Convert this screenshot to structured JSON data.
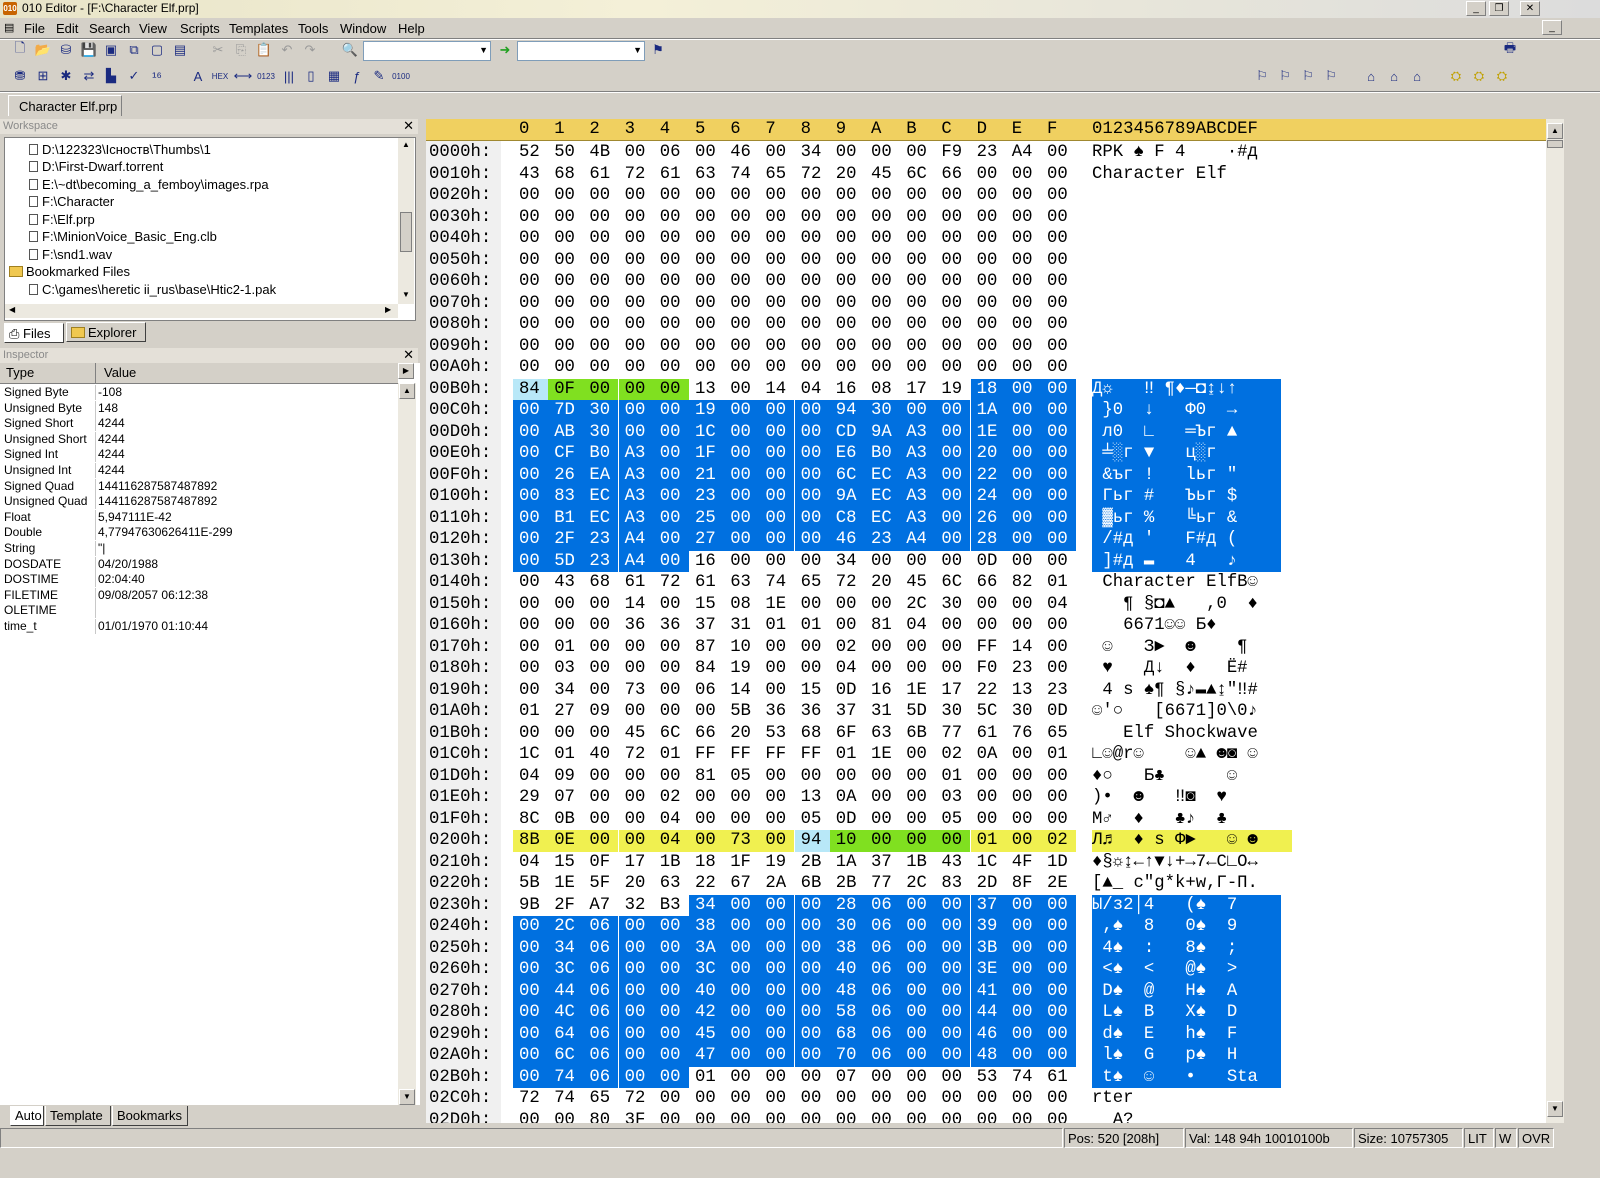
{
  "window": {
    "title": "010 Editor - [F:\\Character Elf.prp]",
    "app_icon": "010"
  },
  "menu": [
    "File",
    "Edit",
    "Search",
    "View",
    "Scripts",
    "Templates",
    "Tools",
    "Window",
    "Help"
  ],
  "toolbar": {
    "find_value": "",
    "goto_value": ""
  },
  "doc_tab": "Character Elf.prp",
  "workspace": {
    "title": "Workspace",
    "files": [
      "D:\\122323\\Існоств\\Thumbs\\1",
      "D:\\First-Dwarf.torrent",
      "E:\\~dt\\becoming_a_femboy\\images.rpa",
      "F:\\Character",
      "F:\\Elf.prp",
      "F:\\MinionVoice_Basic_Eng.clb",
      "F:\\snd1.wav"
    ],
    "bookmarked_label": "Bookmarked Files",
    "bookmarked": [
      "C:\\games\\heretic ii_rus\\base\\Htic2-1.pak"
    ],
    "tabs": [
      "Files",
      "Explorer"
    ]
  },
  "inspector": {
    "title": "Inspector",
    "col_type": "Type",
    "col_value": "Value",
    "rows": [
      {
        "type": "Signed Byte",
        "value": "-108"
      },
      {
        "type": "Unsigned Byte",
        "value": "148"
      },
      {
        "type": "Signed Short",
        "value": "4244"
      },
      {
        "type": "Unsigned Short",
        "value": "4244"
      },
      {
        "type": "Signed Int",
        "value": "4244"
      },
      {
        "type": "Unsigned Int",
        "value": "4244"
      },
      {
        "type": "Signed Quad",
        "value": "144116287587487892"
      },
      {
        "type": "Unsigned Quad",
        "value": "144116287587487892"
      },
      {
        "type": "Float",
        "value": "5,947111E-42"
      },
      {
        "type": "Double",
        "value": "4,77947630626411E-299"
      },
      {
        "type": "String",
        "value": "\"|"
      },
      {
        "type": "DOSDATE",
        "value": "04/20/1988"
      },
      {
        "type": "DOSTIME",
        "value": "02:04:40"
      },
      {
        "type": "FILETIME",
        "value": "09/08/2057 06:12:38"
      },
      {
        "type": "OLETIME",
        "value": ""
      },
      {
        "type": "time_t",
        "value": "01/01/1970 01:10:44"
      }
    ],
    "tabs": [
      "Auto",
      "Template",
      "Bookmarks"
    ]
  },
  "hex": {
    "columns": [
      "0",
      "1",
      "2",
      "3",
      "4",
      "5",
      "6",
      "7",
      "8",
      "9",
      "A",
      "B",
      "C",
      "D",
      "E",
      "F"
    ],
    "ascii_header": "0123456789ABCDEF",
    "rows": [
      {
        "addr": "0000h:",
        "bytes": "52 50 4B 00 06 00 46 00 34 00 00 00 F9 23 A4 00",
        "ascii": "RPK ♠ F 4    ·#д"
      },
      {
        "addr": "0010h:",
        "bytes": "43 68 61 72 61 63 74 65 72 20 45 6C 66 00 00 00",
        "ascii": "Character Elf"
      },
      {
        "addr": "0020h:",
        "bytes": "00 00 00 00 00 00 00 00 00 00 00 00 00 00 00 00",
        "ascii": ""
      },
      {
        "addr": "0030h:",
        "bytes": "00 00 00 00 00 00 00 00 00 00 00 00 00 00 00 00",
        "ascii": ""
      },
      {
        "addr": "0040h:",
        "bytes": "00 00 00 00 00 00 00 00 00 00 00 00 00 00 00 00",
        "ascii": ""
      },
      {
        "addr": "0050h:",
        "bytes": "00 00 00 00 00 00 00 00 00 00 00 00 00 00 00 00",
        "ascii": ""
      },
      {
        "addr": "0060h:",
        "bytes": "00 00 00 00 00 00 00 00 00 00 00 00 00 00 00 00",
        "ascii": ""
      },
      {
        "addr": "0070h:",
        "bytes": "00 00 00 00 00 00 00 00 00 00 00 00 00 00 00 00",
        "ascii": ""
      },
      {
        "addr": "0080h:",
        "bytes": "00 00 00 00 00 00 00 00 00 00 00 00 00 00 00 00",
        "ascii": ""
      },
      {
        "addr": "0090h:",
        "bytes": "00 00 00 00 00 00 00 00 00 00 00 00 00 00 00 00",
        "ascii": ""
      },
      {
        "addr": "00A0h:",
        "bytes": "00 00 00 00 00 00 00 00 00 00 00 00 00 00 00 00",
        "ascii": ""
      },
      {
        "addr": "00B0h:",
        "bytes": "84 0F 00 00 00 13 00 14 04 16 08 17 19 18 00 00",
        "ascii": "Д☼   ‼ ¶♦—◘↨↓↑  "
      },
      {
        "addr": "00C0h:",
        "bytes": "00 7D 30 00 00 19 00 00 00 94 30 00 00 1A 00 00",
        "ascii": " }0  ↓   Ф0  →  "
      },
      {
        "addr": "00D0h:",
        "bytes": "00 AB 30 00 00 1C 00 00 00 CD 9A A3 00 1E 00 00",
        "ascii": " л0  ∟   ═Ъг ▲  "
      },
      {
        "addr": "00E0h:",
        "bytes": "00 CF B0 A3 00 1F 00 00 00 E6 B0 A3 00 20 00 00",
        "ascii": " ╧░г ▼   ц░г    "
      },
      {
        "addr": "00F0h:",
        "bytes": "00 26 EA A3 00 21 00 00 00 6C EC A3 00 22 00 00",
        "ascii": " &ъг !   lьг \"  "
      },
      {
        "addr": "0100h:",
        "bytes": "00 83 EC A3 00 23 00 00 00 9A EC A3 00 24 00 00",
        "ascii": " Гьг #   Ъьг $  "
      },
      {
        "addr": "0110h:",
        "bytes": "00 B1 EC A3 00 25 00 00 00 C8 EC A3 00 26 00 00",
        "ascii": " ▓ьг %   ╚ьг &  "
      },
      {
        "addr": "0120h:",
        "bytes": "00 2F 23 A4 00 27 00 00 00 46 23 A4 00 28 00 00",
        "ascii": " /#д '   F#д (  "
      },
      {
        "addr": "0130h:",
        "bytes": "00 5D 23 A4 00 16 00 00 00 34 00 00 00 0D 00 00",
        "ascii": " ]#д ▬   4   ♪  "
      },
      {
        "addr": "0140h:",
        "bytes": "00 43 68 61 72 61 63 74 65 72 20 45 6C 66 82 01",
        "ascii": " Character ElfВ☺"
      },
      {
        "addr": "0150h:",
        "bytes": "00 00 00 14 00 15 08 1E 00 00 00 2C 30 00 00 04",
        "ascii": "   ¶ §◘▲   ,0  ♦"
      },
      {
        "addr": "0160h:",
        "bytes": "00 00 00 36 36 37 31 01 01 00 81 04 00 00 00 00",
        "ascii": "   6671☺☺ Б♦    "
      },
      {
        "addr": "0170h:",
        "bytes": "00 01 00 00 00 87 10 00 00 02 00 00 00 FF 14 00",
        "ascii": " ☺   З►  ☻    ¶ "
      },
      {
        "addr": "0180h:",
        "bytes": "00 03 00 00 00 84 19 00 00 04 00 00 00 F0 23 00",
        "ascii": " ♥   Д↓  ♦   Ё# "
      },
      {
        "addr": "0190h:",
        "bytes": "00 34 00 73 00 06 14 00 15 0D 16 1E 17 22 13 23",
        "ascii": " 4 s ♠¶ §♪▬▲↨\"‼#"
      },
      {
        "addr": "01A0h:",
        "bytes": "01 27 09 00 00 00 5B 36 36 37 31 5D 30 5C 30 0D",
        "ascii": "☺'○   [6671]0\\0♪"
      },
      {
        "addr": "01B0h:",
        "bytes": "00 00 00 45 6C 66 20 53 68 6F 63 6B 77 61 76 65",
        "ascii": "   Elf Shockwave"
      },
      {
        "addr": "01C0h:",
        "bytes": "1C 01 40 72 01 FF FF FF FF 01 1E 00 02 0A 00 01",
        "ascii": "∟☺@r☺    ☺▲ ☻◙ ☺"
      },
      {
        "addr": "01D0h:",
        "bytes": "04 09 00 00 00 81 05 00 00 00 00 00 01 00 00 00",
        "ascii": "♦○   Б♣      ☺   "
      },
      {
        "addr": "01E0h:",
        "bytes": "29 07 00 00 02 00 00 00 13 0A 00 00 03 00 00 00",
        "ascii": ")•  ☻   ‼◙  ♥   "
      },
      {
        "addr": "01F0h:",
        "bytes": "8C 0B 00 00 04 00 00 00 05 0D 00 00 05 00 00 00",
        "ascii": "М♂  ♦   ♣♪  ♣   "
      },
      {
        "addr": "0200h:",
        "bytes": "8B 0E 00 00 04 00 73 00 94 10 00 00 00 01 00 02",
        "ascii": "Л♬  ♦ s Ф►   ☺ ☻"
      },
      {
        "addr": "0210h:",
        "bytes": "04 15 0F 17 1B 18 1F 19 2B 1A 37 1B 43 1C 4F 1D",
        "ascii": "♦§☼↨←↑▼↓+→7←C∟O↔"
      },
      {
        "addr": "0220h:",
        "bytes": "5B 1E 5F 20 63 22 67 2A 6B 2B 77 2C 83 2D 8F 2E",
        "ascii": "[▲_ c\"g*k+w,Г-П."
      },
      {
        "addr": "0230h:",
        "bytes": "9B 2F A7 32 B3 34 00 00 00 28 06 00 00 37 00 00",
        "ascii": "Ы/з2│4   (♠  7  "
      },
      {
        "addr": "0240h:",
        "bytes": "00 2C 06 00 00 38 00 00 00 30 06 00 00 39 00 00",
        "ascii": " ,♠  8   0♠  9  "
      },
      {
        "addr": "0250h:",
        "bytes": "00 34 06 00 00 3A 00 00 00 38 06 00 00 3B 00 00",
        "ascii": " 4♠  :   8♠  ;  "
      },
      {
        "addr": "0260h:",
        "bytes": "00 3C 06 00 00 3C 00 00 00 40 06 00 00 3E 00 00",
        "ascii": " <♠  <   @♠  >  "
      },
      {
        "addr": "0270h:",
        "bytes": "00 44 06 00 00 40 00 00 00 48 06 00 00 41 00 00",
        "ascii": " D♠  @   H♠  A  "
      },
      {
        "addr": "0280h:",
        "bytes": "00 4C 06 00 00 42 00 00 00 58 06 00 00 44 00 00",
        "ascii": " L♠  B   X♠  D  "
      },
      {
        "addr": "0290h:",
        "bytes": "00 64 06 00 00 45 00 00 00 68 06 00 00 46 00 00",
        "ascii": " d♠  E   h♠  F  "
      },
      {
        "addr": "02A0h:",
        "bytes": "00 6C 06 00 00 47 00 00 00 70 06 00 00 48 00 00",
        "ascii": " l♠  G   p♠  H  "
      },
      {
        "addr": "02B0h:",
        "bytes": "00 74 06 00 00 01 00 00 00 07 00 00 00 53 74 61",
        "ascii": " t♠  ☺   •   Sta"
      },
      {
        "addr": "02C0h:",
        "bytes": "72 74 65 72 00 00 00 00 00 00 00 00 00 00 00 00",
        "ascii": "rter"
      },
      {
        "addr": "02D0h:",
        "bytes": "00 00 80 3F 00 00 00 00 00 00 00 00 00 00 00 00",
        "ascii": "  А?"
      }
    ]
  },
  "status": {
    "pos": "Pos: 520 [208h]",
    "val": "Val: 148 94h 10010100b",
    "size": "Size: 10757305",
    "lit": "LIT",
    "w": "W",
    "ovr": "OVR"
  }
}
